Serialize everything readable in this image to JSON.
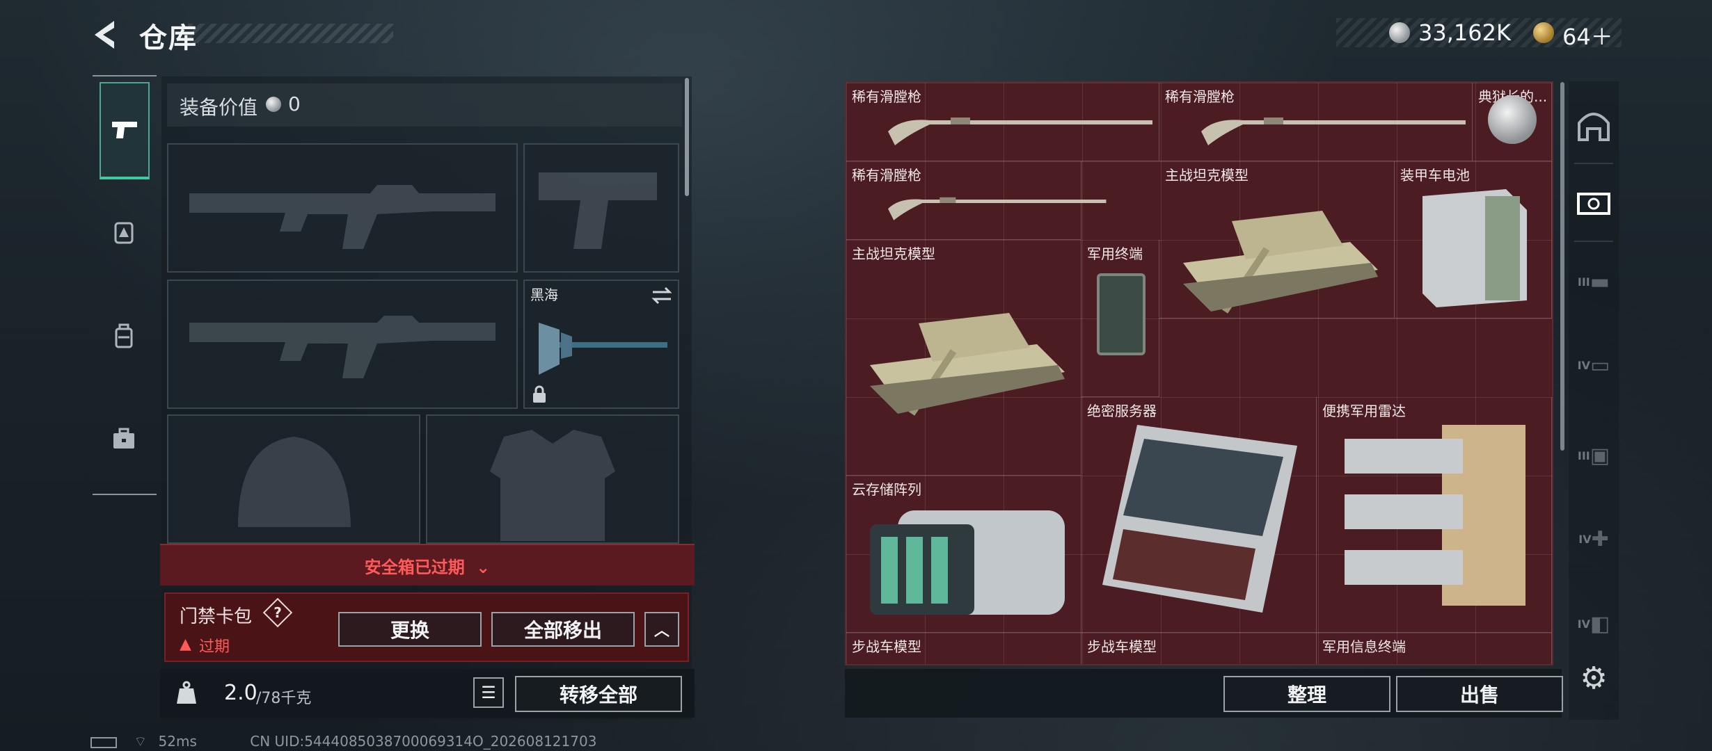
{
  "header": {
    "title": "仓库",
    "silver_amount": "33,162K",
    "gold_amount": "64＋"
  },
  "equipment": {
    "value_label": "装备价值",
    "value": "0",
    "melee_name": "黑海",
    "safebox_expired": "安全箱已过期",
    "keycard_title": "门禁卡包",
    "keycard_help": "?",
    "keycard_status": "过期",
    "btn_replace": "更换",
    "btn_remove_all": "全部移出",
    "weight_current": "2.0",
    "weight_capacity": "/78千克",
    "btn_transfer_all": "转移全部"
  },
  "stash": {
    "items": [
      {
        "name": "稀有滑膛枪"
      },
      {
        "name": "稀有滑膛枪"
      },
      {
        "name": "典狱长的..."
      },
      {
        "name": "稀有滑膛枪"
      },
      {
        "name": "主战坦克模型"
      },
      {
        "name": "装甲车电池"
      },
      {
        "name": "主战坦克模型"
      },
      {
        "name": "军用终端"
      },
      {
        "name": "绝密服务器"
      },
      {
        "name": "便携军用雷达"
      },
      {
        "name": "云存储阵列"
      },
      {
        "name": "步战车模型"
      },
      {
        "name": "步战车模型"
      },
      {
        "name": "军用信息终端"
      }
    ],
    "btn_sort": "整理",
    "btn_sell": "出售"
  },
  "side_labels": {
    "iii_a": "III",
    "iv_a": "IV",
    "iii_b": "III",
    "iv_b": "IV",
    "iv_c": "IV"
  },
  "footer": {
    "ping": "52ms",
    "uid": "CN UID:5444085038700069314O_202608121703"
  },
  "colors": {
    "accent": "#3fcaa0",
    "stash_bg": "#4b1d22",
    "alert": "#ff5a5a"
  }
}
